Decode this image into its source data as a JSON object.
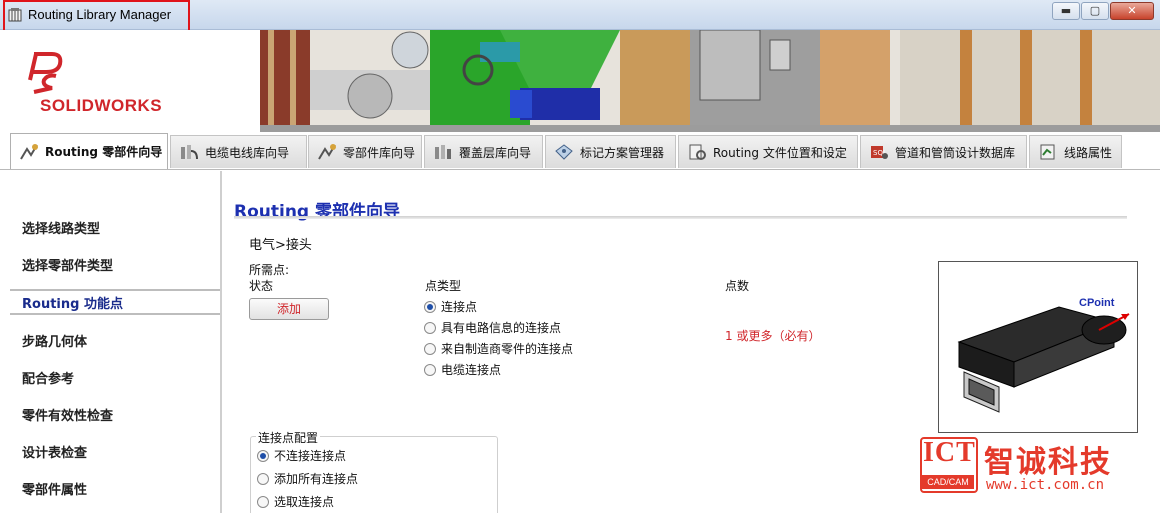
{
  "window": {
    "title": "Routing Library Manager",
    "minimize_glyph": "▬",
    "maximize_glyph": "▢",
    "close_glyph": "✕"
  },
  "brand": {
    "logo_text": "SOLIDWORKS",
    "accent_color": "#d0262b"
  },
  "tabs": [
    {
      "label": "Routing 零部件向导",
      "icon": "component-wizard-icon",
      "active": true
    },
    {
      "label": "电缆电线库向导",
      "icon": "cable-library-icon",
      "active": false
    },
    {
      "label": "零部件库向导",
      "icon": "part-library-icon",
      "active": false
    },
    {
      "label": "覆盖层库向导",
      "icon": "covering-library-icon",
      "active": false
    },
    {
      "label": "标记方案管理器",
      "icon": "tag-scheme-icon",
      "active": false
    },
    {
      "label": "Routing 文件位置和设定",
      "icon": "file-location-icon",
      "active": false
    },
    {
      "label": "管道和管筒设计数据库",
      "icon": "database-icon",
      "active": false
    },
    {
      "label": "线路属性",
      "icon": "route-properties-icon",
      "active": false
    }
  ],
  "sidebar": {
    "items": [
      {
        "label": "选择线路类型",
        "active": false
      },
      {
        "label": "选择零部件类型",
        "active": false
      },
      {
        "label": "Routing 功能点",
        "active": true
      },
      {
        "label": "步路几何体",
        "active": false
      },
      {
        "label": "配合参考",
        "active": false
      },
      {
        "label": "零件有效性检查",
        "active": false
      },
      {
        "label": "设计表检查",
        "active": false
      },
      {
        "label": "零部件属性",
        "active": false
      }
    ]
  },
  "main": {
    "title": "Routing 零部件向导",
    "breadcrumb": "电气>接头",
    "required_points_label": "所需点:",
    "status_header": "状态",
    "point_type_header": "点类型",
    "count_header": "点数",
    "add_button": "添加",
    "point_types": [
      {
        "label": "连接点",
        "selected": true
      },
      {
        "label": "具有电路信息的连接点",
        "selected": false
      },
      {
        "label": "来自制造商零件的连接点",
        "selected": false
      },
      {
        "label": "电缆连接点",
        "selected": false
      }
    ],
    "count_value": "1 或更多（必有）",
    "connection_config": {
      "label": "连接点配置",
      "options": [
        {
          "label": "不连接连接点",
          "selected": true
        },
        {
          "label": "添加所有连接点",
          "selected": false
        },
        {
          "label": "选取连接点",
          "selected": false
        }
      ]
    },
    "preview_label": "CPoint"
  },
  "watermark": {
    "logo_text": "ICT",
    "logo_sub": "CAD/CAM",
    "company": "智诚科技",
    "url": "www.ict.com.cn"
  }
}
